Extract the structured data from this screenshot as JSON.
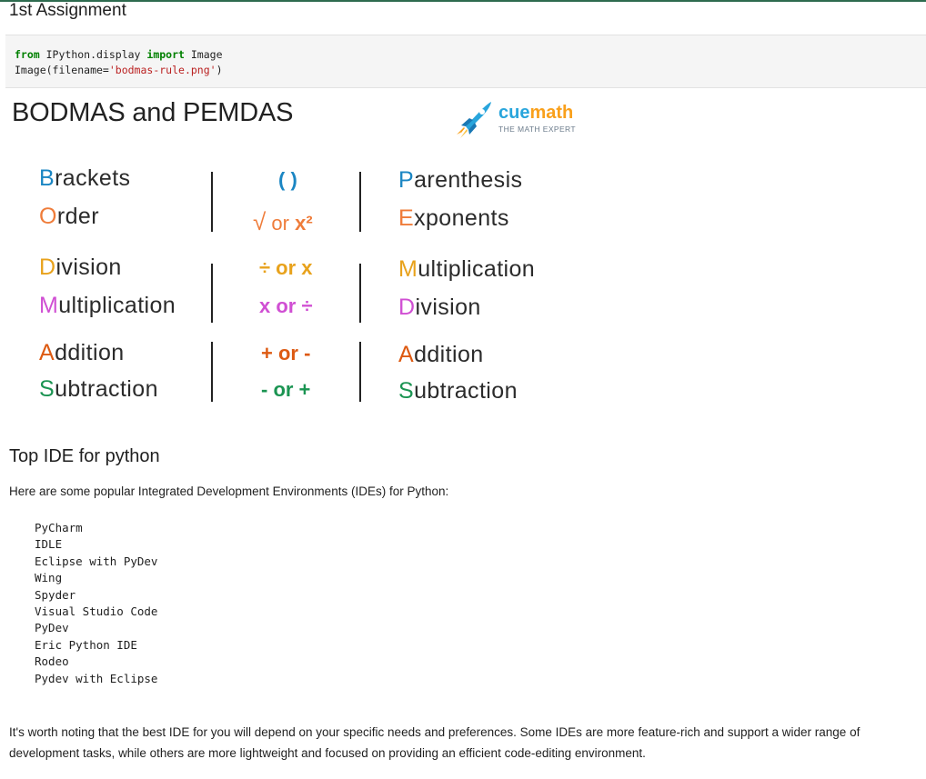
{
  "cell_heading": "1st Assignment",
  "code": {
    "line1": {
      "kw1": "from",
      "module": " IPython.display ",
      "kw2": "import",
      "name": " Image"
    },
    "line2": {
      "prefix": "Image(filename=",
      "string": "'bodmas-rule.png'",
      "suffix": ")"
    }
  },
  "bodmas_image": {
    "title": "BODMAS and PEMDAS",
    "logo": {
      "name_part1": "cue",
      "name_part2": "math",
      "tagline": "THE MATH EXPERT"
    },
    "rows": [
      {
        "left_first": "B",
        "left_rest": "rackets",
        "symbol": "( )",
        "right_first": "P",
        "right_rest": "arenthesis",
        "color": "#1b86c3"
      },
      {
        "left_first": "O",
        "left_rest": "rder",
        "symbol_root": "√",
        "symbol_mid": " or ",
        "symbol_end": "x²",
        "right_first": "E",
        "right_rest": "xponents",
        "color": "#ef7c3a"
      },
      {
        "left_first": "D",
        "left_rest": "ivision",
        "symbol": "÷ or x",
        "right_first": "M",
        "right_rest": "ultiplication",
        "color": "#e8a21c"
      },
      {
        "left_first": "M",
        "left_rest": "ultiplication",
        "symbol": "x or ÷",
        "right_first": "D",
        "right_rest": "ivision",
        "color": "#d04fd3"
      },
      {
        "left_first": "A",
        "left_rest": "ddition",
        "symbol": "+ or -",
        "right_first": "A",
        "right_rest": "ddition",
        "color": "#dd5a12"
      },
      {
        "left_first": "S",
        "left_rest": "ubtraction",
        "symbol": "- or +",
        "right_first": "S",
        "right_rest": "ubtraction",
        "color": "#1b9452"
      }
    ]
  },
  "markdown": {
    "heading": "Top IDE for python",
    "intro": "Here are some popular Integrated Development Environments (IDEs) for Python:",
    "ides": [
      "PyCharm",
      "IDLE",
      "Eclipse with PyDev",
      "Wing",
      "Spyder",
      "Visual Studio Code",
      "PyDev",
      "Eric Python IDE",
      "Rodeo",
      "Pydev with Eclipse"
    ],
    "closing_line1": "It's worth noting that the best IDE for you will depend on your specific needs and preferences. Some IDEs are more feature-rich and support a wider range of",
    "closing_line2": "development tasks, while others are more lightweight and focused on providing an efficient code-editing environment."
  }
}
